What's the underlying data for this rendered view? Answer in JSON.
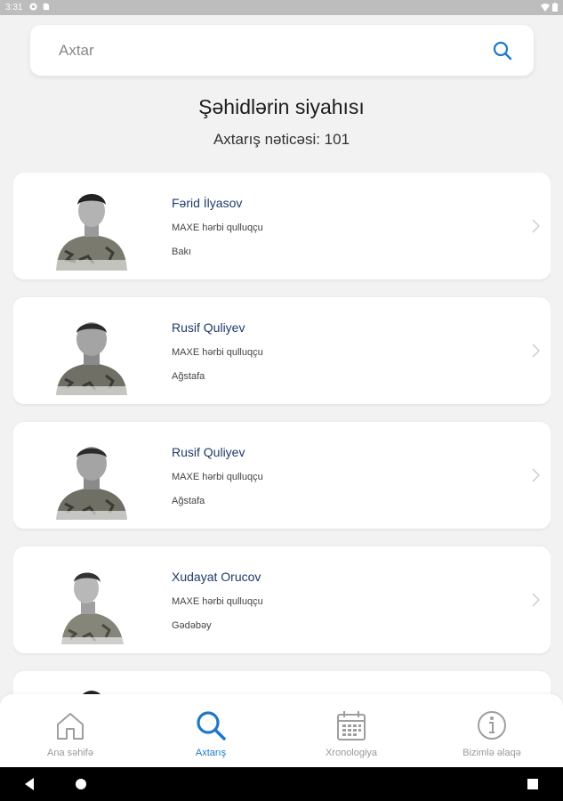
{
  "status_bar": {
    "time": "3:31"
  },
  "search": {
    "placeholder": "Axtar"
  },
  "header": {
    "title": "Şəhidlərin siyahısı",
    "result_count": "Axtarış nəticəsi: 101"
  },
  "cards": [
    {
      "name": "Fərid İlyasov",
      "role": "MAXE hərbi qulluqçu",
      "city": "Bakı"
    },
    {
      "name": "Rusif Quliyev",
      "role": "MAXE hərbi qulluqçu",
      "city": "Ağstafa"
    },
    {
      "name": "Rusif Quliyev",
      "role": "MAXE hərbi qulluqçu",
      "city": "Ağstafa"
    },
    {
      "name": "Xudayat Orucov",
      "role": "MAXE hərbi qulluqçu",
      "city": "Gədəbəy"
    }
  ],
  "nav": [
    {
      "label": "Ana səhifə",
      "icon": "home-icon"
    },
    {
      "label": "Axtarış",
      "icon": "search-icon",
      "active": true
    },
    {
      "label": "Xronologiya",
      "icon": "calendar-icon"
    },
    {
      "label": "Bizimlə əlaqə",
      "icon": "info-icon"
    }
  ],
  "colors": {
    "accent": "#1e78c8",
    "name_text": "#1f3a68",
    "background": "#f2f2f2"
  }
}
